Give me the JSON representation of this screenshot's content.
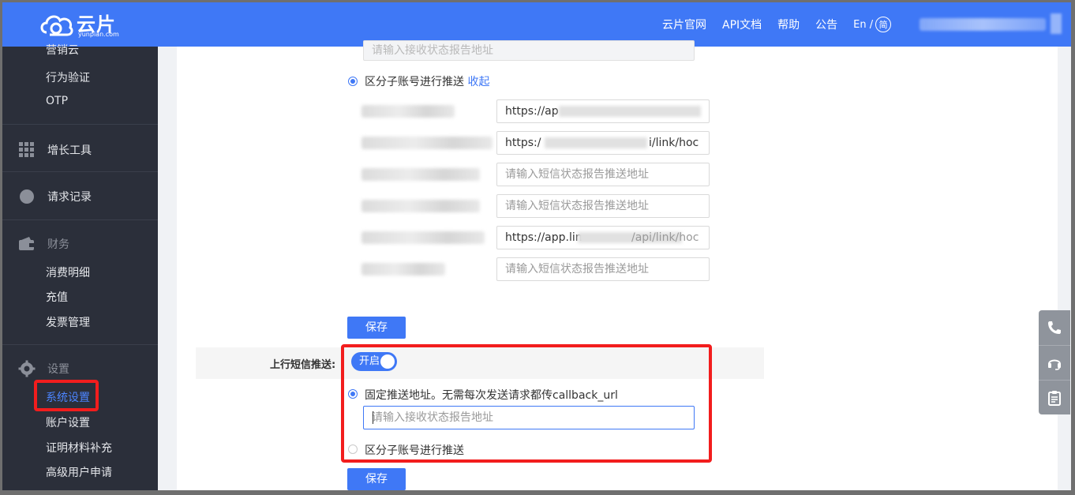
{
  "brand": {
    "name": "云片",
    "sub": "yunpian.com"
  },
  "topnav": {
    "items": [
      "云片官网",
      "API文档",
      "帮助",
      "公告"
    ],
    "lang": "En /",
    "lang_alt": "简"
  },
  "sidebar": {
    "partial_top": "营销云",
    "sub_items_a": [
      "行为验证",
      "OTP"
    ],
    "growth": "增长工具",
    "requests": "请求记录",
    "finance": "财务",
    "finance_items": [
      "消费明细",
      "充值",
      "发票管理"
    ],
    "settings": "设置",
    "settings_items": [
      "系统设置",
      "账户设置",
      "证明材料补充",
      "高级用户申请"
    ],
    "active": "系统设置"
  },
  "status_push": {
    "top_input_placeholder": "请输入接收状态报告地址",
    "radio_label": "区分子账号进行推送",
    "collapse_link": "收起",
    "subaccount_inputs": [
      {
        "value": "https://ap",
        "placeholder": ""
      },
      {
        "value": "https:/",
        "value_tail": "i/link/hoc",
        "placeholder": ""
      },
      {
        "value": "",
        "placeholder": "请输入短信状态报告推送地址"
      },
      {
        "value": "",
        "placeholder": "请输入短信状态报告推送地址"
      },
      {
        "value": "https://app.lin",
        "value_tail": "/api/link/hoc",
        "placeholder": ""
      },
      {
        "value": "",
        "placeholder": "请输入短信状态报告推送地址"
      }
    ],
    "save": "保存"
  },
  "uplink": {
    "label": "上行短信推送:",
    "toggle": "开启",
    "option_fixed": "固定推送地址。无需每次发送请求都传callback_url",
    "fixed_placeholder": "请输入接收状态报告地址",
    "option_sub": "区分子账号进行推送",
    "save": "保存"
  },
  "float_tools": [
    "phone-icon",
    "headset-icon",
    "clipboard-icon"
  ],
  "colors": {
    "primary": "#3f78f6",
    "sidebar": "#2b2f3a",
    "highlight": "#f21d1d"
  }
}
